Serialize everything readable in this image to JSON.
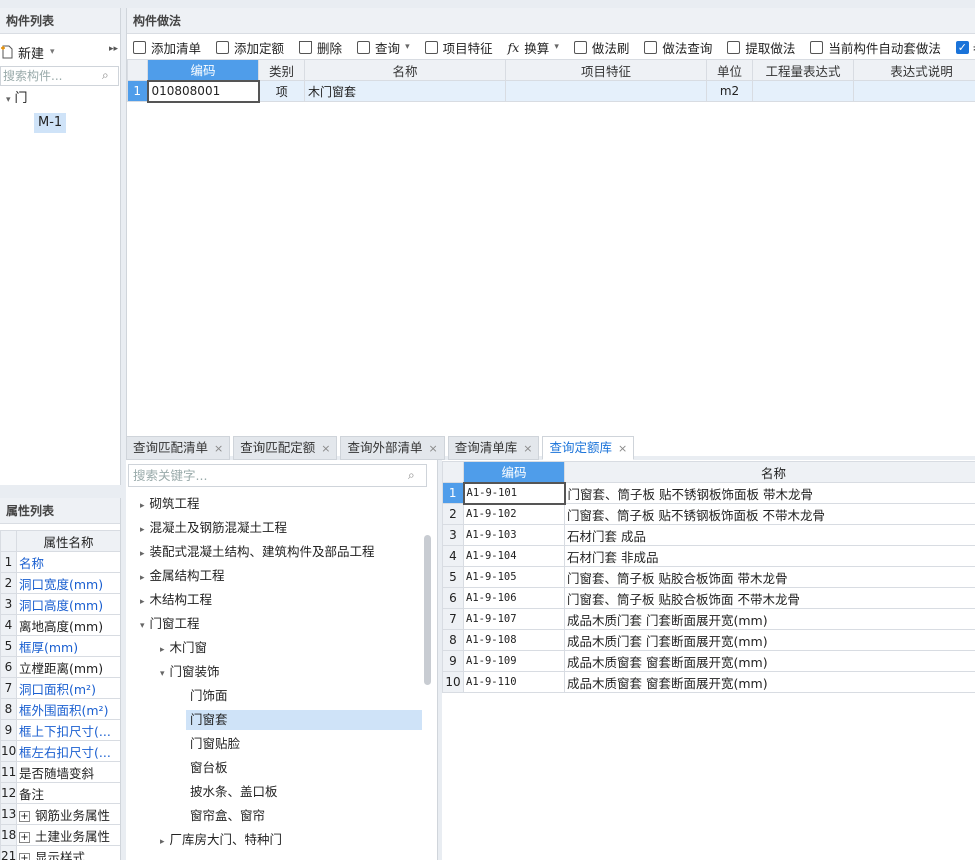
{
  "comp_list": {
    "title": "构件列表",
    "new_label": "新建",
    "search_placeholder": "搜索构件...",
    "tree": [
      {
        "label": "门"
      },
      {
        "label": "M-1"
      }
    ]
  },
  "method": {
    "title": "构件做法",
    "toolbar": [
      {
        "label": "添加清单"
      },
      {
        "label": "添加定额"
      },
      {
        "label": "删除"
      },
      {
        "label": "查询"
      },
      {
        "label": "项目特征"
      },
      {
        "label": "换算"
      },
      {
        "label": "做法刷"
      },
      {
        "label": "做法查询"
      },
      {
        "label": "提取做法"
      },
      {
        "label": "当前构件自动套做法"
      },
      {
        "label": "参与"
      }
    ],
    "columns": [
      "编码",
      "类别",
      "名称",
      "项目特征",
      "单位",
      "工程量表达式",
      "表达式说明"
    ],
    "rows": [
      {
        "num": "1",
        "code": "010808001",
        "type": "项",
        "name": "木门窗套",
        "feature": "",
        "unit": "m2",
        "expr": "",
        "expr_desc": ""
      }
    ]
  },
  "props": {
    "title": "属性列表",
    "header": "属性名称",
    "rows": [
      {
        "num": "1",
        "name": "名称",
        "color": "blue"
      },
      {
        "num": "2",
        "name": "洞口宽度(mm)",
        "color": "blue"
      },
      {
        "num": "3",
        "name": "洞口高度(mm)",
        "color": "blue"
      },
      {
        "num": "4",
        "name": "离地高度(mm)",
        "color": "black"
      },
      {
        "num": "5",
        "name": "框厚(mm)",
        "color": "blue"
      },
      {
        "num": "6",
        "name": "立樘距离(mm)",
        "color": "black"
      },
      {
        "num": "7",
        "name": "洞口面积(m²)",
        "color": "blue"
      },
      {
        "num": "8",
        "name": "框外围面积(m²)",
        "color": "blue"
      },
      {
        "num": "9",
        "name": "框上下扣尺寸(...",
        "color": "blue"
      },
      {
        "num": "10",
        "name": "框左右扣尺寸(...",
        "color": "blue"
      },
      {
        "num": "11",
        "name": "是否随墙变斜",
        "color": "black"
      },
      {
        "num": "12",
        "name": "备注",
        "color": "black"
      },
      {
        "num": "13",
        "name": "钢筋业务属性",
        "color": "black"
      },
      {
        "num": "18",
        "name": "土建业务属性",
        "color": "black"
      },
      {
        "num": "21",
        "name": "显示样式",
        "color": "black"
      }
    ]
  },
  "tabs": [
    {
      "label": "查询匹配清单"
    },
    {
      "label": "查询匹配定额"
    },
    {
      "label": "查询外部清单"
    },
    {
      "label": "查询清单库"
    },
    {
      "label": "查询定额库"
    }
  ],
  "quota_tree": {
    "search_placeholder": "搜索关键字...",
    "items": [
      {
        "label": "砌筑工程"
      },
      {
        "label": "混凝土及钢筋混凝土工程"
      },
      {
        "label": "装配式混凝土结构、建筑构件及部品工程"
      },
      {
        "label": "金属结构工程"
      },
      {
        "label": "木结构工程"
      },
      {
        "label": "门窗工程"
      },
      {
        "label": "木门窗"
      },
      {
        "label": "门窗装饰"
      },
      {
        "label": "门饰面"
      },
      {
        "label": "门窗套"
      },
      {
        "label": "门窗贴脸"
      },
      {
        "label": "窗台板"
      },
      {
        "label": "披水条、盖口板"
      },
      {
        "label": "窗帘盒、窗帘"
      },
      {
        "label": "厂库房大门、特种门"
      }
    ]
  },
  "quota_table": {
    "columns": [
      "编码",
      "名称"
    ],
    "rows": [
      {
        "num": "1",
        "code": "A1-9-101",
        "name": "门窗套、筒子板 贴不锈钢板饰面板 带木龙骨"
      },
      {
        "num": "2",
        "code": "A1-9-102",
        "name": "门窗套、筒子板 贴不锈钢板饰面板 不带木龙骨"
      },
      {
        "num": "3",
        "code": "A1-9-103",
        "name": "石材门套 成品"
      },
      {
        "num": "4",
        "code": "A1-9-104",
        "name": "石材门套 非成品"
      },
      {
        "num": "5",
        "code": "A1-9-105",
        "name": "门窗套、筒子板 贴胶合板饰面 带木龙骨"
      },
      {
        "num": "6",
        "code": "A1-9-106",
        "name": "门窗套、筒子板 贴胶合板饰面 不带木龙骨"
      },
      {
        "num": "7",
        "code": "A1-9-107",
        "name": "成品木质门套 门套断面展开宽(mm)"
      },
      {
        "num": "8",
        "code": "A1-9-108",
        "name": "成品木质门套 门套断面展开宽(mm)"
      },
      {
        "num": "9",
        "code": "A1-9-109",
        "name": "成品木质窗套 窗套断面展开宽(mm)"
      },
      {
        "num": "10",
        "code": "A1-9-110",
        "name": "成品木质窗套 窗套断面展开宽(mm)"
      }
    ]
  }
}
